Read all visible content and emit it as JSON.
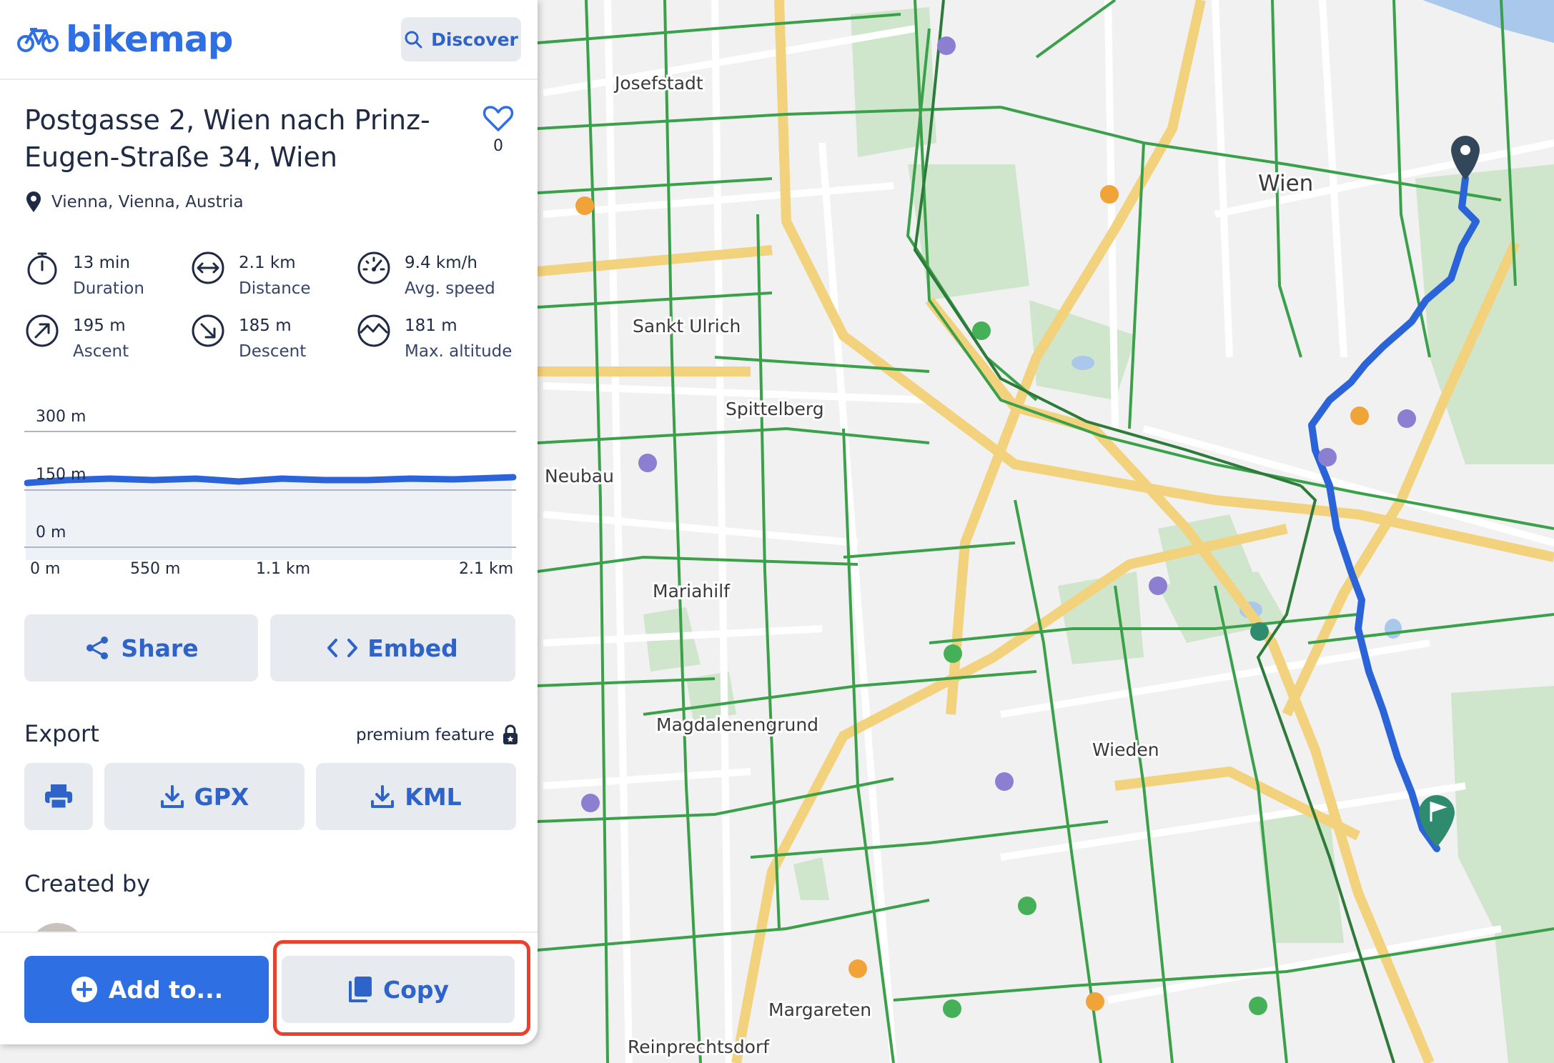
{
  "app": {
    "logo_text": "bikemap",
    "discover_label": "Discover"
  },
  "route": {
    "title": "Postgasse 2, Wien nach Prinz-Eugen-Straße 34, Wien",
    "favorites_count": "0",
    "location": "Vienna, Vienna, Austria"
  },
  "stats": [
    {
      "icon": "stopwatch-icon",
      "value": "13 min",
      "label": "Duration"
    },
    {
      "icon": "distance-arrows-icon",
      "value": "2.1 km",
      "label": "Distance"
    },
    {
      "icon": "speedometer-icon",
      "value": "9.4 km/h",
      "label": "Avg. speed"
    },
    {
      "icon": "ascent-arrow-icon",
      "value": "195 m",
      "label": "Ascent"
    },
    {
      "icon": "descent-arrow-icon",
      "value": "185 m",
      "label": "Descent"
    },
    {
      "icon": "mountain-icon",
      "value": "181 m",
      "label": "Max. altitude"
    }
  ],
  "profile": {
    "y_ticks": [
      "300 m",
      "150 m",
      "0 m"
    ],
    "x_ticks": [
      "0 m",
      "550 m",
      "1.1 km",
      "2.1 km"
    ]
  },
  "actions": {
    "share_label": "Share",
    "embed_label": "Embed"
  },
  "export": {
    "title": "Export",
    "premium_label": "premium feature",
    "gpx_label": "GPX",
    "kml_label": "KML"
  },
  "created_by_label": "Created by",
  "footer": {
    "add_label": "Add to...",
    "copy_label": "Copy"
  },
  "map": {
    "labels": [
      "Josefstadt",
      "Wien",
      "Sankt Ulrich",
      "Spittelberg",
      "Neubau",
      "Mariahilf",
      "Magdalenengrund",
      "Wieden",
      "Margareten",
      "Reinprechtsdorf"
    ]
  },
  "colors": {
    "accent": "#2f6fe4",
    "bike_lane": "#3aa14a",
    "route": "#2b63d8",
    "highlight": "#e8422e",
    "finish_marker": "#2e8b6e",
    "start_marker": "#33475b"
  }
}
